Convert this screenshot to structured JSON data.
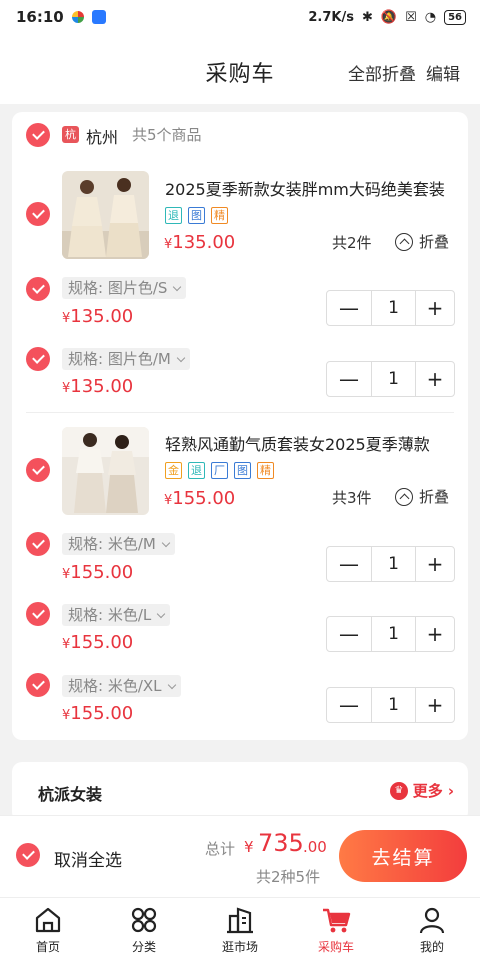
{
  "status": {
    "time": "16:10",
    "net_speed": "2.7K/s",
    "battery": "56"
  },
  "header": {
    "title": "采购车",
    "collapse_all": "全部折叠",
    "edit": "编辑"
  },
  "store": {
    "badge": "杭",
    "name": "杭州",
    "count": "共5个商品"
  },
  "products": [
    {
      "title": "2025夏季新款女装胖mm大码绝美套装",
      "tags": [
        {
          "label": "退",
          "color": "#2fb8b8"
        },
        {
          "label": "图",
          "color": "#3a7bd5"
        },
        {
          "label": "精",
          "color": "#f08a24"
        }
      ],
      "price_yen": "¥",
      "price": "135.00",
      "count": "共2件",
      "fold": "折叠",
      "skus": [
        {
          "spec": "规格: 图片色/S",
          "yen": "¥",
          "price": "135.00",
          "qty": "1"
        },
        {
          "spec": "规格: 图片色/M",
          "yen": "¥",
          "price": "135.00",
          "qty": "1"
        }
      ]
    },
    {
      "title": "轻熟风通勤气质套装女2025夏季薄款",
      "tags": [
        {
          "label": "金",
          "color": "#f0a020"
        },
        {
          "label": "退",
          "color": "#2fb8b8"
        },
        {
          "label": "厂",
          "color": "#3a7bd5"
        },
        {
          "label": "图",
          "color": "#3a7bd5"
        },
        {
          "label": "精",
          "color": "#f08a24"
        }
      ],
      "price_yen": "¥",
      "price": "155.00",
      "count": "共3件",
      "fold": "折叠",
      "skus": [
        {
          "spec": "规格: 米色/M",
          "yen": "¥",
          "price": "155.00",
          "qty": "1"
        },
        {
          "spec": "规格: 米色/L",
          "yen": "¥",
          "price": "155.00",
          "qty": "1"
        },
        {
          "spec": "规格: 米色/XL",
          "yen": "¥",
          "price": "155.00",
          "qty": "1"
        }
      ]
    }
  ],
  "stepper": {
    "minus": "—",
    "plus": "+"
  },
  "recommend": {
    "title": "杭派女装",
    "more": "更多"
  },
  "footer": {
    "deselect_all": "取消全选",
    "total_label": "总计",
    "total_yen": "¥",
    "total_value": "735",
    "total_decimal": ".00",
    "total_sub": "共2种5件",
    "checkout": "去结算"
  },
  "tabs": [
    {
      "label": "首页",
      "icon": "home-icon"
    },
    {
      "label": "分类",
      "icon": "category-icon"
    },
    {
      "label": "逛市场",
      "icon": "market-icon"
    },
    {
      "label": "采购车",
      "icon": "cart-icon",
      "active": true
    },
    {
      "label": "我的",
      "icon": "profile-icon"
    }
  ],
  "colors": {
    "accent": "#e8343e",
    "check": "#f4515c"
  }
}
